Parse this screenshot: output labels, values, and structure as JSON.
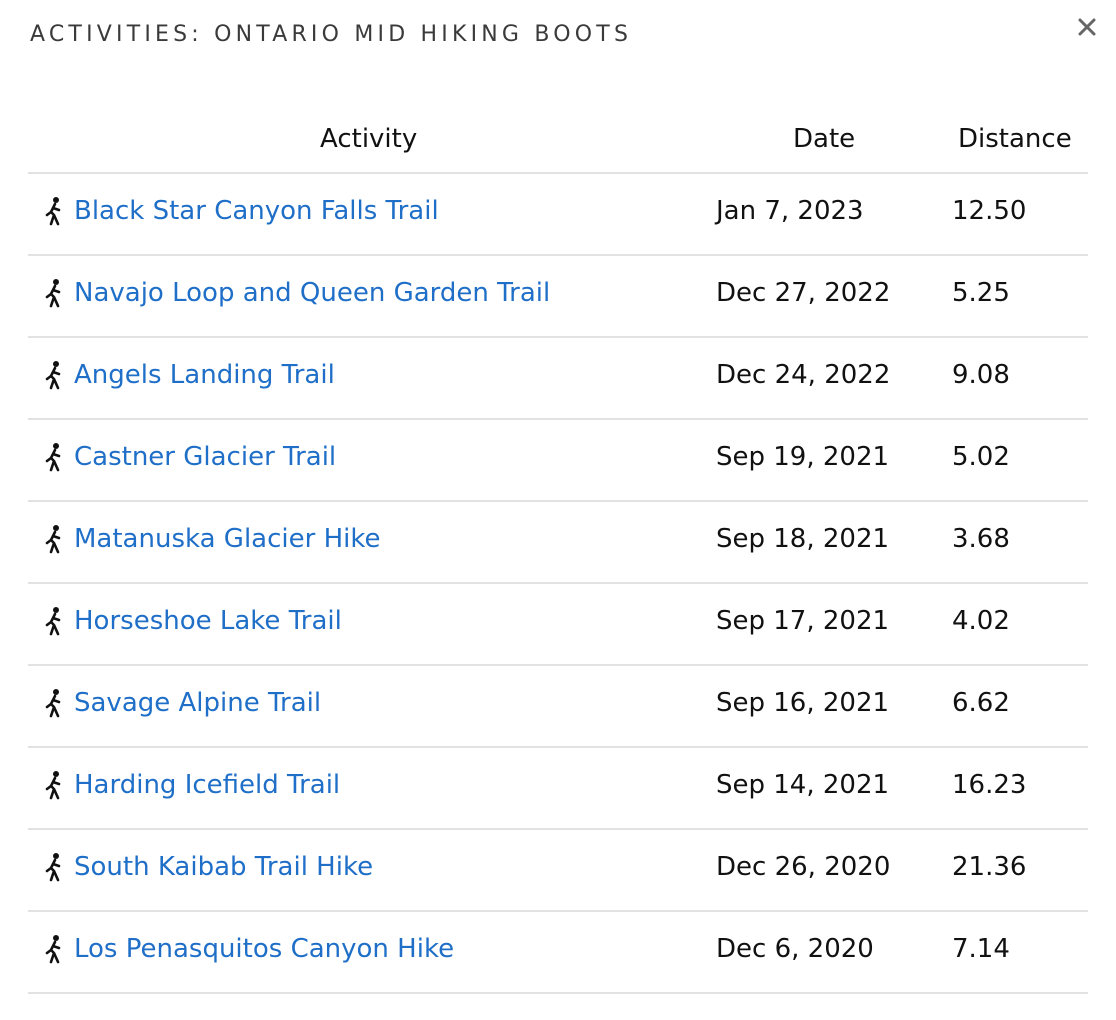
{
  "modal": {
    "title": "ACTIVITIES: ONTARIO MID HIKING BOOTS",
    "close_icon": "close-icon"
  },
  "table": {
    "headers": {
      "activity": "Activity",
      "date": "Date",
      "distance": "Distance"
    },
    "row_icon": "hiking-icon",
    "link_color": "#1f6fc8",
    "rows": [
      {
        "activity": "Black Star Canyon Falls Trail",
        "date": "Jan 7, 2023",
        "distance": "12.50"
      },
      {
        "activity": "Navajo Loop and Queen Garden Trail",
        "date": "Dec 27, 2022",
        "distance": "5.25"
      },
      {
        "activity": "Angels Landing Trail",
        "date": "Dec 24, 2022",
        "distance": "9.08"
      },
      {
        "activity": "Castner Glacier Trail",
        "date": "Sep 19, 2021",
        "distance": "5.02"
      },
      {
        "activity": "Matanuska Glacier Hike",
        "date": "Sep 18, 2021",
        "distance": "3.68"
      },
      {
        "activity": "Horseshoe Lake Trail",
        "date": "Sep 17, 2021",
        "distance": "4.02"
      },
      {
        "activity": "Savage Alpine Trail",
        "date": "Sep 16, 2021",
        "distance": "6.62"
      },
      {
        "activity": "Harding Icefield Trail",
        "date": "Sep 14, 2021",
        "distance": "16.23"
      },
      {
        "activity": "South Kaibab Trail Hike",
        "date": "Dec 26, 2020",
        "distance": "21.36"
      },
      {
        "activity": "Los Penasquitos Canyon Hike",
        "date": "Dec 6, 2020",
        "distance": "7.14"
      }
    ]
  }
}
